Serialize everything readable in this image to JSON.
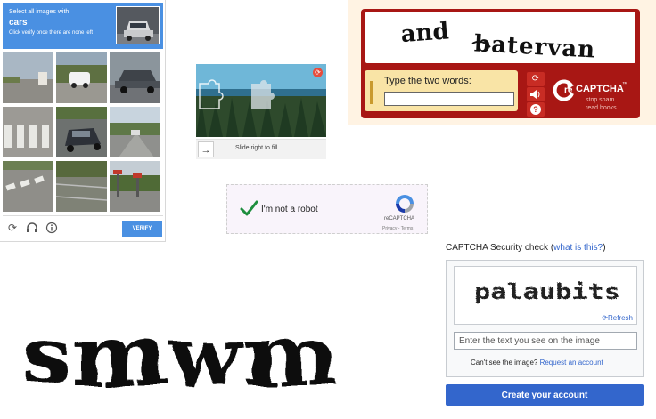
{
  "grid_captcha": {
    "instruction_line1": "Select all images with",
    "target_word": "cars",
    "instruction_line3": "Click verify once there are none left",
    "verify_label": "VERIFY",
    "footer_icons": [
      "reload-icon",
      "audio-icon",
      "info-icon"
    ]
  },
  "slider_captcha": {
    "hint": "Slide right to fill",
    "handle_glyph": "→",
    "refresh_glyph": "⟳"
  },
  "checkbox_captcha": {
    "label": "I'm not a robot",
    "brand": "reCAPTCHA",
    "links": "Privacy - Terms",
    "check_color": "#1e8e3e"
  },
  "classic_captcha": {
    "word1": "and",
    "word2": "batervan",
    "prompt": "Type the two words:",
    "logo_re": "re",
    "logo_main": "CAPTCHA",
    "logo_tm": "™",
    "tagline1": "stop spam.",
    "tagline2": "read books.",
    "buttons": [
      {
        "glyph": "⟳",
        "icon": "refresh-icon"
      },
      {
        "glyph": "🔊",
        "icon": "audio-icon"
      },
      {
        "glyph": "?",
        "icon": "help-icon"
      }
    ],
    "frame_color": "#a81714"
  },
  "distorted_captcha": {
    "text": "smwm"
  },
  "wiki_captcha": {
    "title_prefix": "CAPTCHA Security check (",
    "title_link": "what is this?",
    "title_suffix": ")",
    "image_text": "palaubits",
    "refresh_label": "Refresh",
    "input_placeholder": "Enter the text you see on the image",
    "help_prefix": "Can't see the image? ",
    "help_link": "Request an account",
    "submit_label": "Create your account",
    "accent_color": "#3366cc"
  }
}
